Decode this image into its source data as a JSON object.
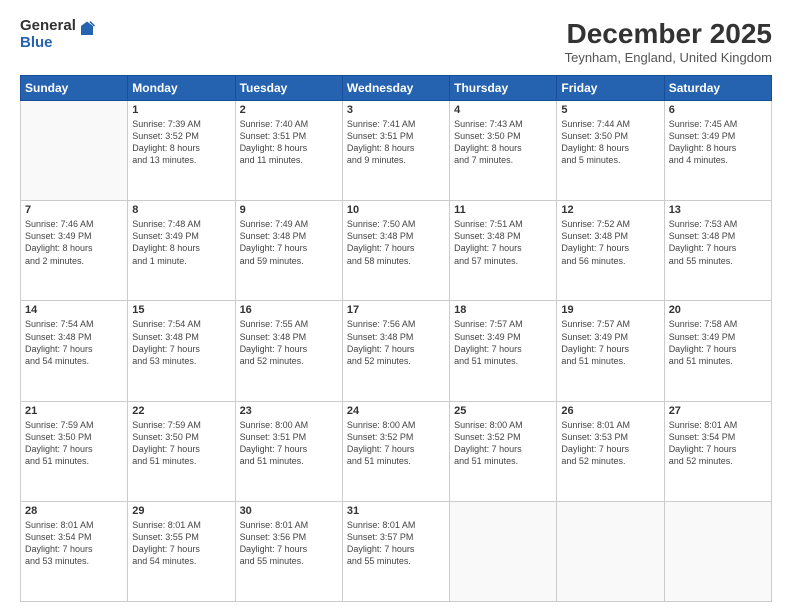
{
  "logo": {
    "general": "General",
    "blue": "Blue"
  },
  "title": "December 2025",
  "location": "Teynham, England, United Kingdom",
  "days": [
    "Sunday",
    "Monday",
    "Tuesday",
    "Wednesday",
    "Thursday",
    "Friday",
    "Saturday"
  ],
  "weeks": [
    [
      {
        "day": "",
        "info": ""
      },
      {
        "day": "1",
        "info": "Sunrise: 7:39 AM\nSunset: 3:52 PM\nDaylight: 8 hours\nand 13 minutes."
      },
      {
        "day": "2",
        "info": "Sunrise: 7:40 AM\nSunset: 3:51 PM\nDaylight: 8 hours\nand 11 minutes."
      },
      {
        "day": "3",
        "info": "Sunrise: 7:41 AM\nSunset: 3:51 PM\nDaylight: 8 hours\nand 9 minutes."
      },
      {
        "day": "4",
        "info": "Sunrise: 7:43 AM\nSunset: 3:50 PM\nDaylight: 8 hours\nand 7 minutes."
      },
      {
        "day": "5",
        "info": "Sunrise: 7:44 AM\nSunset: 3:50 PM\nDaylight: 8 hours\nand 5 minutes."
      },
      {
        "day": "6",
        "info": "Sunrise: 7:45 AM\nSunset: 3:49 PM\nDaylight: 8 hours\nand 4 minutes."
      }
    ],
    [
      {
        "day": "7",
        "info": "Sunrise: 7:46 AM\nSunset: 3:49 PM\nDaylight: 8 hours\nand 2 minutes."
      },
      {
        "day": "8",
        "info": "Sunrise: 7:48 AM\nSunset: 3:49 PM\nDaylight: 8 hours\nand 1 minute."
      },
      {
        "day": "9",
        "info": "Sunrise: 7:49 AM\nSunset: 3:48 PM\nDaylight: 7 hours\nand 59 minutes."
      },
      {
        "day": "10",
        "info": "Sunrise: 7:50 AM\nSunset: 3:48 PM\nDaylight: 7 hours\nand 58 minutes."
      },
      {
        "day": "11",
        "info": "Sunrise: 7:51 AM\nSunset: 3:48 PM\nDaylight: 7 hours\nand 57 minutes."
      },
      {
        "day": "12",
        "info": "Sunrise: 7:52 AM\nSunset: 3:48 PM\nDaylight: 7 hours\nand 56 minutes."
      },
      {
        "day": "13",
        "info": "Sunrise: 7:53 AM\nSunset: 3:48 PM\nDaylight: 7 hours\nand 55 minutes."
      }
    ],
    [
      {
        "day": "14",
        "info": "Sunrise: 7:54 AM\nSunset: 3:48 PM\nDaylight: 7 hours\nand 54 minutes."
      },
      {
        "day": "15",
        "info": "Sunrise: 7:54 AM\nSunset: 3:48 PM\nDaylight: 7 hours\nand 53 minutes."
      },
      {
        "day": "16",
        "info": "Sunrise: 7:55 AM\nSunset: 3:48 PM\nDaylight: 7 hours\nand 52 minutes."
      },
      {
        "day": "17",
        "info": "Sunrise: 7:56 AM\nSunset: 3:48 PM\nDaylight: 7 hours\nand 52 minutes."
      },
      {
        "day": "18",
        "info": "Sunrise: 7:57 AM\nSunset: 3:49 PM\nDaylight: 7 hours\nand 51 minutes."
      },
      {
        "day": "19",
        "info": "Sunrise: 7:57 AM\nSunset: 3:49 PM\nDaylight: 7 hours\nand 51 minutes."
      },
      {
        "day": "20",
        "info": "Sunrise: 7:58 AM\nSunset: 3:49 PM\nDaylight: 7 hours\nand 51 minutes."
      }
    ],
    [
      {
        "day": "21",
        "info": "Sunrise: 7:59 AM\nSunset: 3:50 PM\nDaylight: 7 hours\nand 51 minutes."
      },
      {
        "day": "22",
        "info": "Sunrise: 7:59 AM\nSunset: 3:50 PM\nDaylight: 7 hours\nand 51 minutes."
      },
      {
        "day": "23",
        "info": "Sunrise: 8:00 AM\nSunset: 3:51 PM\nDaylight: 7 hours\nand 51 minutes."
      },
      {
        "day": "24",
        "info": "Sunrise: 8:00 AM\nSunset: 3:52 PM\nDaylight: 7 hours\nand 51 minutes."
      },
      {
        "day": "25",
        "info": "Sunrise: 8:00 AM\nSunset: 3:52 PM\nDaylight: 7 hours\nand 51 minutes."
      },
      {
        "day": "26",
        "info": "Sunrise: 8:01 AM\nSunset: 3:53 PM\nDaylight: 7 hours\nand 52 minutes."
      },
      {
        "day": "27",
        "info": "Sunrise: 8:01 AM\nSunset: 3:54 PM\nDaylight: 7 hours\nand 52 minutes."
      }
    ],
    [
      {
        "day": "28",
        "info": "Sunrise: 8:01 AM\nSunset: 3:54 PM\nDaylight: 7 hours\nand 53 minutes."
      },
      {
        "day": "29",
        "info": "Sunrise: 8:01 AM\nSunset: 3:55 PM\nDaylight: 7 hours\nand 54 minutes."
      },
      {
        "day": "30",
        "info": "Sunrise: 8:01 AM\nSunset: 3:56 PM\nDaylight: 7 hours\nand 55 minutes."
      },
      {
        "day": "31",
        "info": "Sunrise: 8:01 AM\nSunset: 3:57 PM\nDaylight: 7 hours\nand 55 minutes."
      },
      {
        "day": "",
        "info": ""
      },
      {
        "day": "",
        "info": ""
      },
      {
        "day": "",
        "info": ""
      }
    ]
  ]
}
